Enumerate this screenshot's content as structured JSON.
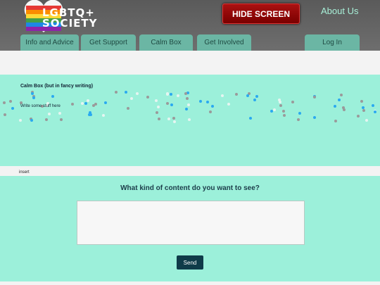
{
  "header": {
    "logo_line1": "LGBTQ+",
    "logo_line2": "SOCIETY",
    "hide_label": "HIDE SCREEN",
    "about_label": "About Us"
  },
  "nav": {
    "tabs": [
      {
        "label": "Info and Advice"
      },
      {
        "label": "Get Support"
      },
      {
        "label": "Calm Box"
      },
      {
        "label": "Get Involved"
      }
    ],
    "login_label": "Log In"
  },
  "calm_box": {
    "title": "Calm Box (but in fancy writing)",
    "text": "Write some stuff here"
  },
  "insert_label": "insert",
  "feedback": {
    "question": "What kind of content do you want to see?",
    "input_value": "",
    "send_label": "Send"
  },
  "colors": {
    "header_bg": "#5f5f5f",
    "tab_bg": "#6bb6a4",
    "band_bg": "#9cf0da",
    "hide_red": "#8a0000",
    "send_bg": "#0f3b49",
    "dot_blue": "#2aa9f0",
    "dot_grey": "#9a9a9a",
    "dot_white": "#e6f5f1"
  }
}
